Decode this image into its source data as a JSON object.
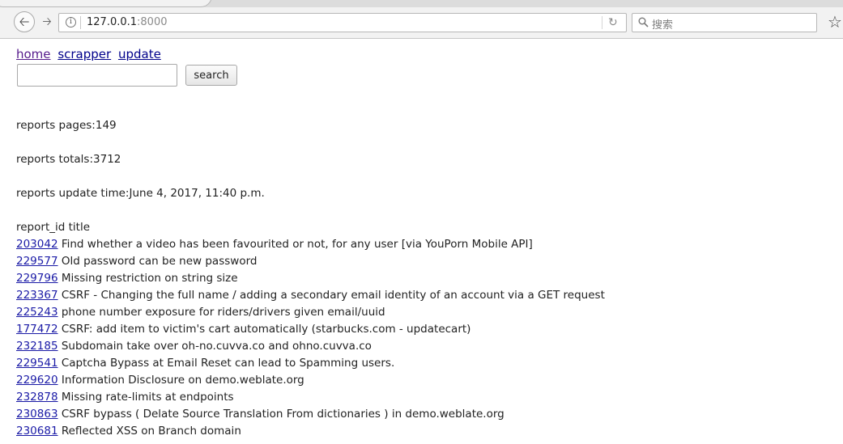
{
  "browser": {
    "url_host": "127.0.0.1",
    "url_port": ":8000",
    "search_placeholder": "搜索",
    "icons": {
      "back": "back-arrow-icon",
      "forward": "forward-arrow-icon",
      "site_info": "info-icon",
      "reload": "reload-icon",
      "search": "search-icon",
      "bookmark": "star-icon"
    }
  },
  "nav": {
    "home": "home",
    "scrapper": "scrapper",
    "update": "update"
  },
  "search": {
    "input_value": "",
    "button_label": "search"
  },
  "stats": {
    "pages_label": "reports pages:",
    "pages_value": "149",
    "totals_label": "reports totals:",
    "totals_value": "3712",
    "update_label": "reports update time:",
    "update_value": "June 4, 2017, 11:40 p.m."
  },
  "list": {
    "header_id": "report_id",
    "header_title": "title",
    "reports": [
      {
        "id": "203042",
        "title": "Find whether a video has been favourited or not, for any user [via YouPorn Mobile API]"
      },
      {
        "id": "229577",
        "title": "Old password can be new password"
      },
      {
        "id": "229796",
        "title": "Missing restriction on string size"
      },
      {
        "id": "223367",
        "title": "CSRF - Changing the full name / adding a secondary email identity of an account via a GET request"
      },
      {
        "id": "225243",
        "title": "phone number exposure for riders/drivers given email/uuid"
      },
      {
        "id": "177472",
        "title": "CSRF: add item to victim's cart automatically (starbucks.com - updatecart)"
      },
      {
        "id": "232185",
        "title": "Subdomain take over oh-no.cuvva.co and ohno.cuvva.co"
      },
      {
        "id": "229541",
        "title": "Captcha Bypass at Email Reset can lead to Spamming users."
      },
      {
        "id": "229620",
        "title": "Information Disclosure on demo.weblate.org"
      },
      {
        "id": "232878",
        "title": "Missing rate-limits at endpoints"
      },
      {
        "id": "230863",
        "title": "CSRF bypass ( Delate Source Translation From dictionaries ) in demo.weblate.org"
      },
      {
        "id": "230681",
        "title": "Reflected XSS on Branch domain"
      }
    ]
  }
}
